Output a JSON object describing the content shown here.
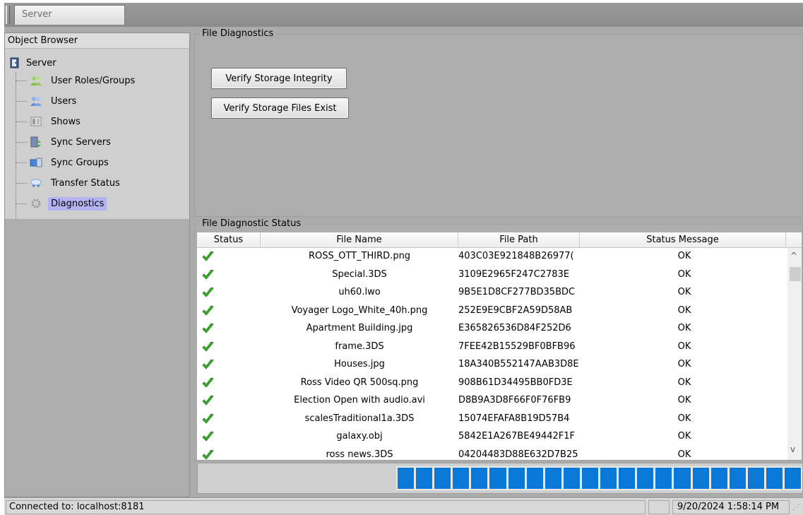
{
  "tabs": [
    {
      "label": "Server"
    }
  ],
  "object_browser": {
    "title": "Object Browser",
    "root": {
      "label": "Server",
      "icon": "server-door-icon"
    },
    "items": [
      {
        "label": "User Roles/Groups",
        "icon": "user-roles-icon"
      },
      {
        "label": "Users",
        "icon": "users-icon"
      },
      {
        "label": "Shows",
        "icon": "shows-icon"
      },
      {
        "label": "Sync Servers",
        "icon": "sync-servers-icon"
      },
      {
        "label": "Sync Groups",
        "icon": "sync-groups-icon"
      },
      {
        "label": "Transfer Status",
        "icon": "transfer-status-icon"
      },
      {
        "label": "Diagnostics",
        "icon": "gear-icon",
        "selected": true
      }
    ]
  },
  "file_diagnostics": {
    "title": "File Diagnostics",
    "verify_integrity_label": "Verify Storage Integrity",
    "verify_exist_label": "Verify Storage Files Exist"
  },
  "file_diagnostic_status": {
    "title": "File Diagnostic Status",
    "columns": [
      "Status",
      "File Name",
      "File Path",
      "Status Message"
    ],
    "rows": [
      {
        "status": "check",
        "name": "ROSS_OTT_THIRD.png",
        "path": ")403C03E921848B26977",
        "msg": "OK"
      },
      {
        "status": "check",
        "name": "Special.3DS",
        "path": "3109E2965F247C2783E",
        "msg": "OK"
      },
      {
        "status": "check",
        "name": "uh60.lwo",
        "path": "9B5E1D8CF277BD35BDC",
        "msg": "OK"
      },
      {
        "status": "check",
        "name": "Voyager Logo_White_40h.png",
        "path": "252E9E9CBF2A59D58AB",
        "msg": "OK"
      },
      {
        "status": "check",
        "name": "Apartment Building.jpg",
        "path": "E365826536D84F252D6",
        "msg": "OK"
      },
      {
        "status": "check",
        "name": "frame.3DS",
        "path": "7FEE42B15529BF0BFB96",
        "msg": "OK"
      },
      {
        "status": "check",
        "name": "Houses.jpg",
        "path": "18A340B552147AAB3D8E",
        "msg": "OK"
      },
      {
        "status": "check",
        "name": "Ross Video QR 500sq.png",
        "path": "908B61D34495BB0FD3E",
        "msg": "OK"
      },
      {
        "status": "check",
        "name": "Election Open with audio.avi",
        "path": "D8B9A3D8F66F0F76FB9",
        "msg": "OK"
      },
      {
        "status": "check",
        "name": "scalesTraditional1a.3DS",
        "path": "15074EFAFA8B19D57B4",
        "msg": "OK"
      },
      {
        "status": "check",
        "name": "galaxy.obj",
        "path": "5842E1A267BE49442F1F",
        "msg": "OK"
      },
      {
        "status": "check",
        "name": "ross news.3DS",
        "path": "04204483D88E632D7B25",
        "msg": "OK"
      }
    ]
  },
  "progress": {
    "value": 1.0,
    "blocks": 22,
    "color": "#0a78d7"
  },
  "statusbar": {
    "connection": "Connected to: localhost:8181",
    "datetime": "9/20/2024 1:58:14 PM"
  }
}
